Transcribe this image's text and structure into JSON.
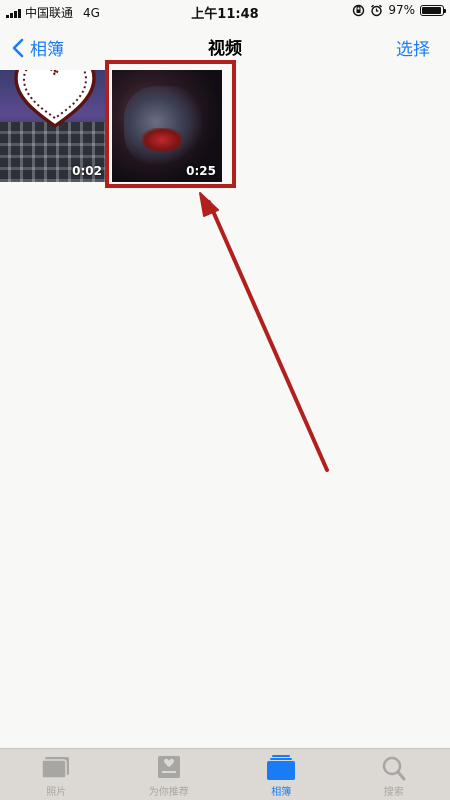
{
  "status_bar": {
    "carrier": "中国联通",
    "network": "4G",
    "time": "上午11:48",
    "battery_percent": "97%",
    "battery_level": 0.97
  },
  "nav": {
    "back_label": "相簿",
    "title": "视频",
    "select_label": "选择"
  },
  "videos": [
    {
      "duration": "0:02"
    },
    {
      "duration": "0:25"
    }
  ],
  "tabs": [
    {
      "label": "照片",
      "icon": "photos-icon",
      "active": false
    },
    {
      "label": "为你推荐",
      "icon": "for-you-icon",
      "active": false
    },
    {
      "label": "相簿",
      "icon": "albums-icon",
      "active": true
    },
    {
      "label": "搜索",
      "icon": "search-icon",
      "active": false
    }
  ],
  "colors": {
    "accent": "#1a7cf5",
    "annotation": "#b1201c",
    "tab_inactive": "#a8a6a3",
    "tab_bar_bg": "#dcd8d3"
  }
}
